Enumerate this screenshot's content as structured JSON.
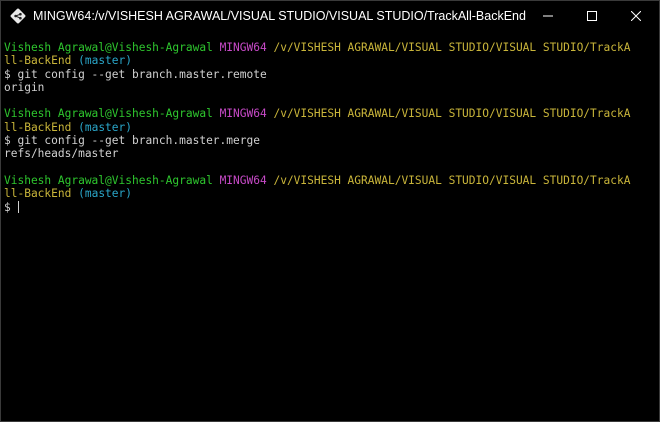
{
  "window": {
    "title": "MINGW64:/v/VISHESH AGRAWAL/VISUAL STUDIO/VISUAL STUDIO/TrackAll-BackEnd",
    "icon": "git-bash-icon",
    "controls": [
      "minimize-icon",
      "maximize-icon",
      "close-icon"
    ]
  },
  "colors": {
    "user": "#2ec62e",
    "shell": "#c74ac7",
    "path": "#c9b53a",
    "branch": "#2aa6c9",
    "text": "#d0d0d0"
  },
  "terminal": {
    "blocks": [
      {
        "prompt": {
          "user": "Vishesh Agrawal@Vishesh-Agrawal",
          "shell": "MINGW64",
          "path_line1": "/v/VISHESH AGRAWAL/VISUAL STUDIO/VISUAL STUDIO/TrackA",
          "path_line2": "ll-BackEnd",
          "branch": "(master)"
        },
        "command": "$ git config --get branch.master.remote",
        "output": "origin"
      },
      {
        "prompt": {
          "user": "Vishesh Agrawal@Vishesh-Agrawal",
          "shell": "MINGW64",
          "path_line1": "/v/VISHESH AGRAWAL/VISUAL STUDIO/VISUAL STUDIO/TrackA",
          "path_line2": "ll-BackEnd",
          "branch": "(master)"
        },
        "command": "$ git config --get branch.master.merge",
        "output": "refs/heads/master"
      },
      {
        "prompt": {
          "user": "Vishesh Agrawal@Vishesh-Agrawal",
          "shell": "MINGW64",
          "path_line1": "/v/VISHESH AGRAWAL/VISUAL STUDIO/VISUAL STUDIO/TrackA",
          "path_line2": "ll-BackEnd",
          "branch": "(master)"
        },
        "command": "$ ",
        "output": ""
      }
    ]
  }
}
